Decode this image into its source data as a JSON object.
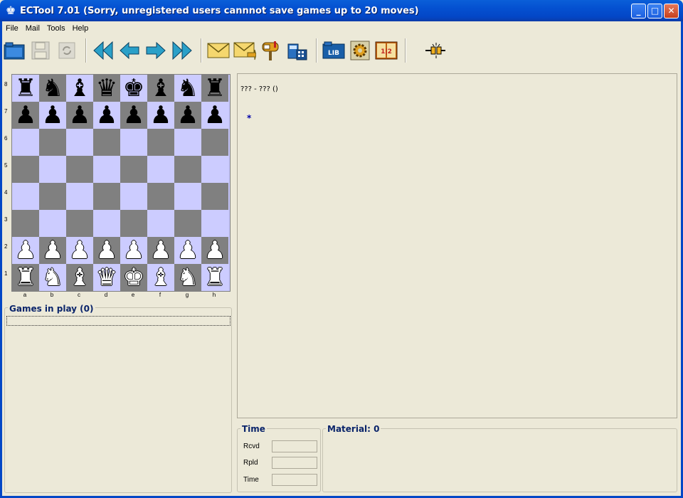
{
  "window": {
    "title": "ECTool 7.01 (Sorry, unregistered users cannnot save games up to 20 moves)",
    "minimize": "_",
    "maximize": "□",
    "close": "✕"
  },
  "menu": [
    "File",
    "Mail",
    "Tools",
    "Help"
  ],
  "toolbar": {
    "groups": [
      [
        "open-icon",
        "save-icon",
        "refresh-icon"
      ],
      [
        "first-move-icon",
        "previous-move-icon",
        "next-move-icon",
        "last-move-icon"
      ],
      [
        "mail-icon",
        "send-mail-icon",
        "mailbox-icon",
        "calculator-icon"
      ],
      [
        "library-icon",
        "settings-icon",
        "book-icon"
      ],
      [
        "connect-icon"
      ]
    ],
    "labels": {
      "library": "LIB",
      "book": "1|2"
    }
  },
  "board": {
    "ranks": [
      "8",
      "7",
      "6",
      "5",
      "4",
      "3",
      "2",
      "1"
    ],
    "files": [
      "a",
      "b",
      "c",
      "d",
      "e",
      "f",
      "g",
      "h"
    ],
    "colors": {
      "light": "#ccccff",
      "dark": "#808080"
    },
    "position": [
      [
        "r",
        "n",
        "b",
        "q",
        "k",
        "b",
        "n",
        "r"
      ],
      [
        "p",
        "p",
        "p",
        "p",
        "p",
        "p",
        "p",
        "p"
      ],
      [
        "",
        "",
        "",
        "",
        "",
        "",
        "",
        ""
      ],
      [
        "",
        "",
        "",
        "",
        "",
        "",
        "",
        ""
      ],
      [
        "",
        "",
        "",
        "",
        "",
        "",
        "",
        ""
      ],
      [
        "",
        "",
        "",
        "",
        "",
        "",
        "",
        ""
      ],
      [
        "P",
        "P",
        "P",
        "P",
        "P",
        "P",
        "P",
        "P"
      ],
      [
        "R",
        "N",
        "B",
        "Q",
        "K",
        "B",
        "N",
        "R"
      ]
    ]
  },
  "games": {
    "title": "Games in play (0)"
  },
  "moves": {
    "header": "??? - ???  ()",
    "result": "*"
  },
  "time": {
    "title": "Time",
    "rows": [
      {
        "label": "Rcvd",
        "value": ""
      },
      {
        "label": "Rpld",
        "value": ""
      },
      {
        "label": "Time",
        "value": ""
      }
    ]
  },
  "material": {
    "title": "Material: 0"
  }
}
